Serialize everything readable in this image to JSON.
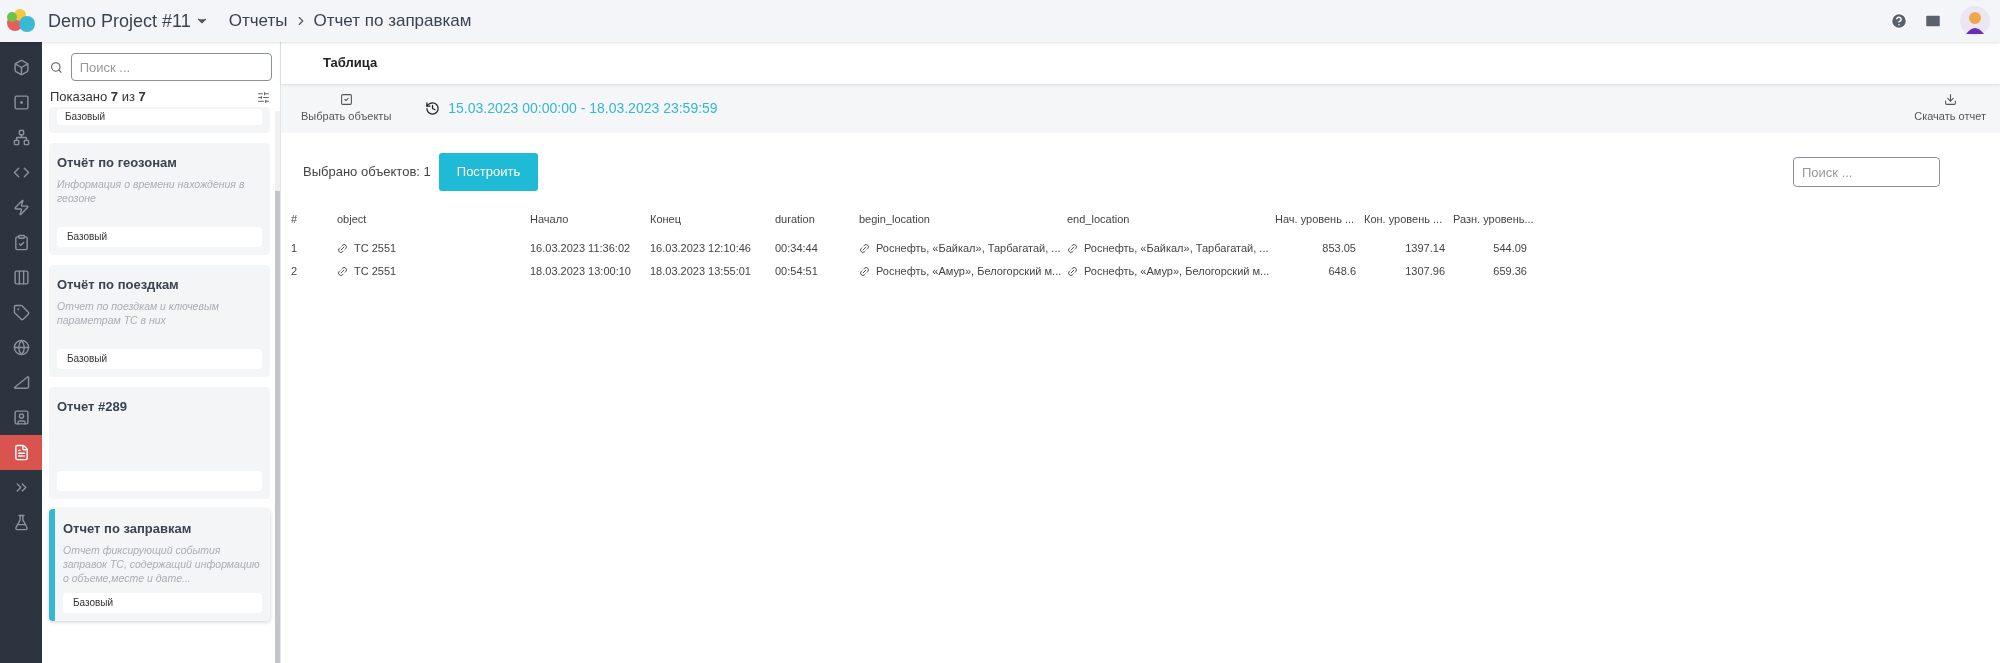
{
  "header": {
    "project": "Demo Project #11",
    "breadcrumbs": [
      "Отчеты",
      "Отчет по заправкам"
    ]
  },
  "rail": [
    {
      "kind": "box",
      "selected": false
    },
    {
      "kind": "square",
      "selected": false
    },
    {
      "kind": "network",
      "selected": false
    },
    {
      "kind": "code",
      "selected": false
    },
    {
      "kind": "bolt",
      "selected": false
    },
    {
      "kind": "clipboard",
      "selected": false
    },
    {
      "kind": "columns",
      "selected": false
    },
    {
      "kind": "tag",
      "selected": false
    },
    {
      "kind": "globe",
      "selected": false
    },
    {
      "kind": "triangle",
      "selected": false
    },
    {
      "kind": "user-file",
      "selected": false
    },
    {
      "kind": "file",
      "selected": true
    },
    {
      "kind": "chevrons",
      "selected": false
    },
    {
      "kind": "flask",
      "selected": false
    }
  ],
  "sidebar": {
    "search": {
      "placeholder": "Поиск ..."
    },
    "shown": "Показано **7** из **7**",
    "cards": [
      {
        "tag": "Базовый",
        "selected": false,
        "partial": true
      },
      {
        "title": "Отчёт по геозонам",
        "description": "Информация о времени нахождения в геозоне",
        "tag": "Базовый",
        "selected": false
      },
      {
        "title": "Отчёт по поездкам",
        "description": "Отчет по поездкам и ключевым параметрам ТС в них",
        "tag": "Базовый",
        "selected": false
      },
      {
        "title": "Отчет #289",
        "selected": false
      },
      {
        "title": "Отчет по заправкам",
        "description": "Отчет фиксирующий события заправок ТС, содержащий информацию о объеме,месте и дате...",
        "tag": "Базовый",
        "selected": true
      }
    ]
  },
  "tabs": [
    {
      "label": "Таблица",
      "selected": true
    }
  ],
  "toolbar": {
    "select_objects": "Выбрать объекты",
    "period": "15.03.2023 00:00:00 - 18.03.2023 23:59:59",
    "download": "Скачать отчет"
  },
  "selection": {
    "label": "Выбрано объектов: 1",
    "build": "Построить"
  },
  "table_search": {
    "placeholder": "Поиск ..."
  },
  "table": {
    "columns": [
      {
        "label": "#",
        "kind": "index"
      },
      {
        "label": "object",
        "kind": "link"
      },
      {
        "label": "Начало",
        "kind": "text"
      },
      {
        "label": "Конец",
        "kind": "text"
      },
      {
        "label": "duration",
        "kind": "text"
      },
      {
        "label": "begin_location",
        "kind": "link"
      },
      {
        "label": "end_location",
        "kind": "link"
      },
      {
        "label": "Нач. уровень ...",
        "kind": "number"
      },
      {
        "label": "Кон. уровень ...",
        "kind": "number"
      },
      {
        "label": "Разн. уровень...",
        "kind": "number"
      }
    ],
    "rows": [
      [
        "1",
        "ТС 2551",
        "16.03.2023 11:36:02",
        "16.03.2023 12:10:46",
        "00:34:44",
        "Роснефть, «Байкал», Тарбагатай, ...",
        "Роснефть, «Байкал», Тарбагатай, ...",
        "853.05",
        "1397.14",
        "544.09"
      ],
      [
        "2",
        "ТС 2551",
        "18.03.2023 13:00:10",
        "18.03.2023 13:55:01",
        "00:54:51",
        "Роснефть, «Амур», Белогорский м...",
        "Роснефть, «Амур», Белогорский м...",
        "648.6",
        "1307.96",
        "659.36"
      ]
    ]
  }
}
